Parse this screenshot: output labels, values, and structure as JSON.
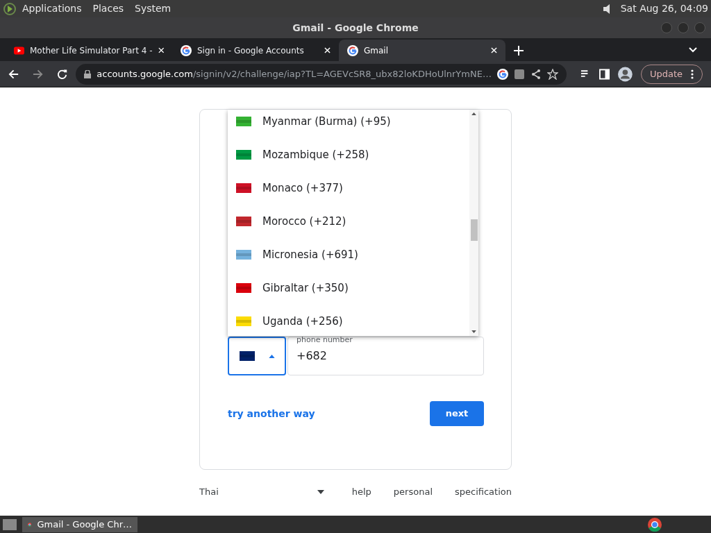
{
  "top_panel": {
    "menus": [
      "Applications",
      "Places",
      "System"
    ],
    "clock": "Sat Aug 26, 04:09"
  },
  "window": {
    "title": "Gmail - Google Chrome"
  },
  "tabs": [
    {
      "title": "Mother Life Simulator Part 4 -",
      "kind": "video",
      "selected": false
    },
    {
      "title": "Sign in - Google Accounts",
      "kind": "google",
      "selected": false
    },
    {
      "title": "Gmail",
      "kind": "google",
      "selected": true
    }
  ],
  "address_bar": {
    "domain": "accounts.google.com",
    "path": "/signin/v2/challenge/iap?TL=AGEVcSR8_ubx82loKDHoUlnrYmNE…"
  },
  "update_button": "Update",
  "country_list": [
    {
      "name": "Myanmar (Burma) (+95)",
      "color": "#34b233"
    },
    {
      "name": "Mozambique (+258)",
      "color": "#009a44"
    },
    {
      "name": "Monaco (+377)",
      "color": "#ce1126"
    },
    {
      "name": "Morocco (+212)",
      "color": "#c1272d"
    },
    {
      "name": "Micronesia (+691)",
      "color": "#75b2dd"
    },
    {
      "name": "Gibraltar (+350)",
      "color": "#da000c"
    },
    {
      "name": "Uganda (+256)",
      "color": "#fcdc04"
    }
  ],
  "phone_field": {
    "label": "phone number",
    "value": "+682",
    "selected_country": {
      "color": "#012169"
    }
  },
  "try_another_way": "try another way",
  "next_button": "next",
  "footer": {
    "language": "Thai",
    "links": [
      "help",
      "personal",
      "specification"
    ]
  },
  "taskbar": {
    "items": [
      {
        "title": "Gmail - Google Chr…",
        "selected": true
      }
    ]
  }
}
